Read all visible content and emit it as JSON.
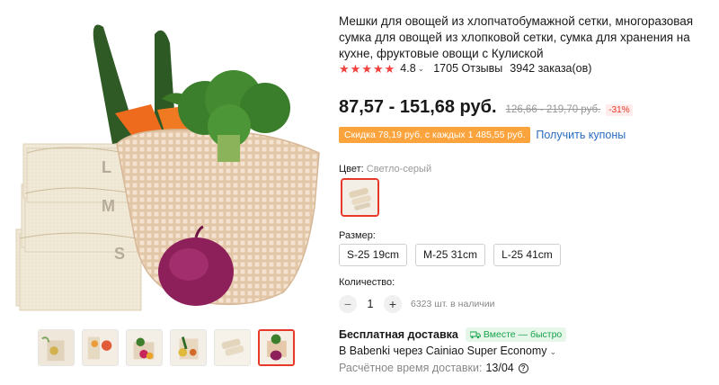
{
  "product": {
    "title": "Мешки для овощей из хлопчатобумажной сетки, многоразовая сумка для овощей из хлопковой сетки, сумка для хранения на кухне, фруктовые овощи с Кулиской",
    "rating": "4.8",
    "reviews": "1705 Отзывы",
    "orders": "3942 заказа(ов)",
    "price": "87,57 - 151,68 руб.",
    "old_price": "126,66 - 219,70 руб.",
    "discount": "-31%",
    "coupon_badge": "Скидка 78,19 руб. с каждых 1 485,55 руб.",
    "coupon_link": "Получить купоны"
  },
  "color": {
    "label": "Цвет:",
    "selected": "Светло-серый"
  },
  "size": {
    "label": "Размер:",
    "options": [
      "S-25 19cm",
      "M-25 31cm",
      "L-25 41cm"
    ]
  },
  "quantity": {
    "label": "Количество:",
    "minus": "−",
    "value": "1",
    "plus": "+",
    "stock": "6323 шт. в наличии"
  },
  "shipping": {
    "title": "Бесплатная доставка",
    "badge": "Вместе — быстро",
    "method": "В Babenki через Cainiao Super Economy",
    "eta_label": "Расчётное время доставки:",
    "eta_value": "13/04"
  },
  "image": {
    "bag_labels": [
      "L",
      "M",
      "S"
    ]
  },
  "colors": {
    "accent": "#e8382a",
    "coupon": "#fba33c",
    "link": "#2a6cc1",
    "green": "#16a34a"
  }
}
